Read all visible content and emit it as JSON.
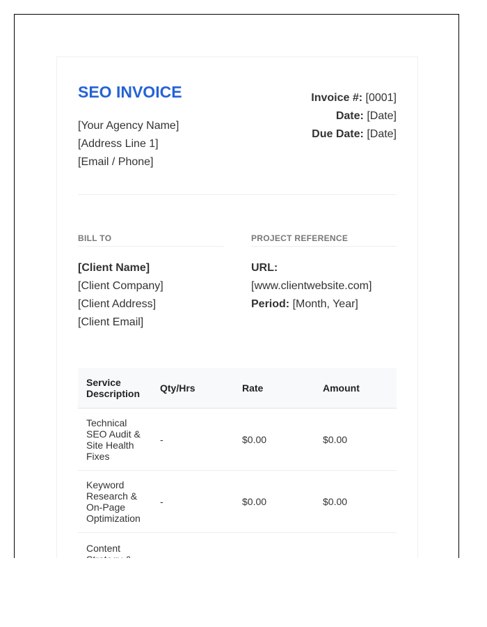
{
  "invoice": {
    "title": "SEO INVOICE",
    "agency": {
      "name": "[Your Agency Name]",
      "address": "[Address Line 1]",
      "contact": "[Email / Phone]"
    },
    "meta": {
      "number_label": "Invoice #:",
      "number_value": "[0001]",
      "date_label": "Date:",
      "date_value": "[Date]",
      "due_label": "Due Date:",
      "due_value": "[Date]"
    }
  },
  "bill_to": {
    "label": "BILL TO",
    "client_name": "[Client Name]",
    "client_company": "[Client Company]",
    "client_address": "[Client Address]",
    "client_email": "[Client Email]"
  },
  "project_reference": {
    "label": "PROJECT REFERENCE",
    "url_label": "URL:",
    "url_value": "[www.clientwebsite.com]",
    "period_label": "Period:",
    "period_value": "[Month, Year]"
  },
  "table": {
    "headers": {
      "service": "Service Description",
      "qty": "Qty/Hrs",
      "rate": "Rate",
      "amount": "Amount"
    },
    "rows": [
      {
        "service": "Technical SEO Audit & Site Health Fixes",
        "qty": "-",
        "rate": "$0.00",
        "amount": "$0.00"
      },
      {
        "service": "Keyword Research & On-Page Optimization",
        "qty": "-",
        "rate": "$0.00",
        "amount": "$0.00"
      },
      {
        "service": "Content Strategy &",
        "qty": "",
        "rate": "",
        "amount": ""
      }
    ]
  },
  "colors": {
    "accent": "#2563d6",
    "header_bg": "#f7f9fb",
    "divider": "#eeeeee"
  }
}
